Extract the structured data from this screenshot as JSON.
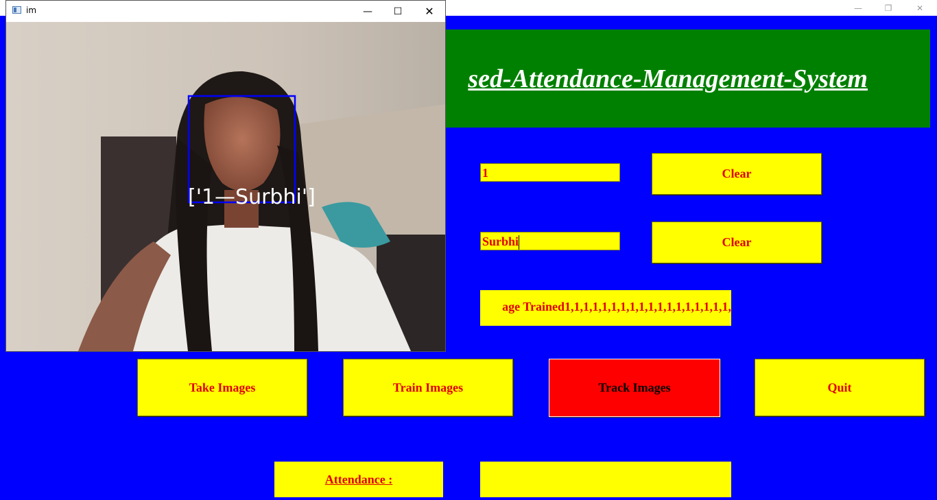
{
  "main_window": {
    "title_buttons": {
      "minimize": "—",
      "maximize": "❐",
      "close": "✕"
    }
  },
  "heading": {
    "text": "sed-Attendance-Management-System"
  },
  "form": {
    "id_value": "1",
    "name_value": "Surbhi",
    "clear_id_label": "Clear",
    "clear_name_label": "Clear",
    "notification": "age Trained1,1,1,1,1,1,1,1,1,1,1,1,1,1,1,1,1,1,"
  },
  "actions": {
    "take_images": "Take Images",
    "train_images": "Train Images",
    "track_images": "Track Images",
    "quit": "Quit"
  },
  "attendance": {
    "label": "Attendance :",
    "value": ""
  },
  "camera_window": {
    "title": "im",
    "detection_label": "['1—Surbhi']",
    "controls": {
      "minimize": "—",
      "maximize": "☐",
      "close": "✕"
    }
  },
  "colors": {
    "background": "#0000ff",
    "heading_bg": "#008000",
    "field_bg": "#ffff00",
    "field_text": "#e00000",
    "track_button_bg": "#ff0000",
    "detection_box": "#0000ff",
    "detection_text": "#ffffff"
  }
}
